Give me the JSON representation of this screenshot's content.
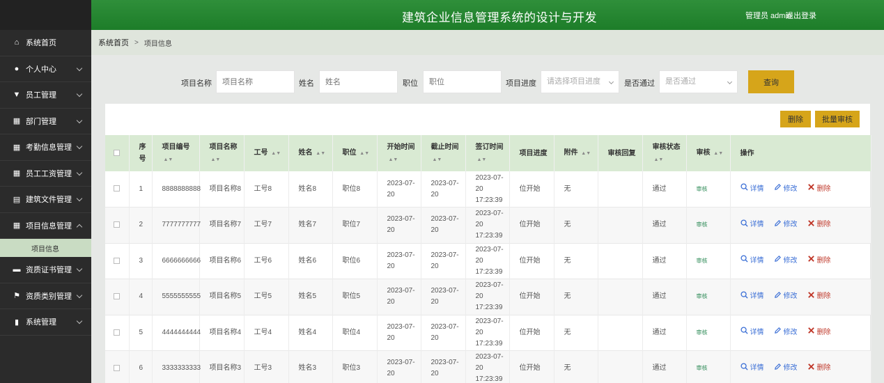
{
  "header": {
    "title": "建筑企业信息管理系统的设计与开发",
    "user_label": "管理员 admin",
    "logout": "退出登录"
  },
  "breadcrumb": {
    "home": "系统首页",
    "current": "项目信息"
  },
  "sidebar": {
    "items": [
      {
        "label": "系统首页",
        "icon": "home-icon"
      },
      {
        "label": "个人中心",
        "icon": "user-icon"
      },
      {
        "label": "员工管理",
        "icon": "trophy-icon"
      },
      {
        "label": "部门管理",
        "icon": "grid-icon"
      },
      {
        "label": "考勤信息管理",
        "icon": "grid-icon"
      },
      {
        "label": "员工工资管理",
        "icon": "table-icon"
      },
      {
        "label": "建筑文件管理",
        "icon": "clipboard-icon"
      },
      {
        "label": "项目信息管理",
        "icon": "grid-icon"
      },
      {
        "label": "资质证书管理",
        "icon": "ticket-icon"
      },
      {
        "label": "资质类别管理",
        "icon": "flag-icon"
      },
      {
        "label": "系统管理",
        "icon": "bar-chart-icon"
      }
    ],
    "sub_item": "项目信息"
  },
  "search": {
    "project_name_label": "项目名称",
    "project_name_placeholder": "项目名称",
    "name_label": "姓名",
    "name_placeholder": "姓名",
    "position_label": "职位",
    "position_placeholder": "职位",
    "progress_label": "项目进度",
    "progress_placeholder": "请选择项目进度",
    "passed_label": "是否通过",
    "passed_placeholder": "是否通过",
    "query_button": "查询"
  },
  "toolbar": {
    "delete_button": "删除",
    "batch_audit_button": "批量审核"
  },
  "table": {
    "headers": {
      "index": "序号",
      "code": "项目编号",
      "name": "项目名称",
      "job_no": "工号",
      "person": "姓名",
      "position": "职位",
      "start": "开始时间",
      "end": "截止时间",
      "sign": "签订时间",
      "progress": "项目进度",
      "attachment": "附件",
      "reply": "审核回复",
      "status": "审核状态",
      "audit": "审核",
      "ops": "操作"
    },
    "rows": [
      {
        "idx": "1",
        "code": "8888888888",
        "name": "项目名称8",
        "job": "工号8",
        "person": "姓名8",
        "pos": "职位8",
        "start": "2023-07-20",
        "end": "2023-07-20",
        "sign": "2023-07-20 17:23:39",
        "progress": "位开始",
        "att": "无",
        "reply": "",
        "status": "通过",
        "audit": "审核"
      },
      {
        "idx": "2",
        "code": "7777777777",
        "name": "项目名称7",
        "job": "工号7",
        "person": "姓名7",
        "pos": "职位7",
        "start": "2023-07-20",
        "end": "2023-07-20",
        "sign": "2023-07-20 17:23:39",
        "progress": "位开始",
        "att": "无",
        "reply": "",
        "status": "通过",
        "audit": "审核"
      },
      {
        "idx": "3",
        "code": "6666666666",
        "name": "项目名称6",
        "job": "工号6",
        "person": "姓名6",
        "pos": "职位6",
        "start": "2023-07-20",
        "end": "2023-07-20",
        "sign": "2023-07-20 17:23:39",
        "progress": "位开始",
        "att": "无",
        "reply": "",
        "status": "通过",
        "audit": "审核"
      },
      {
        "idx": "4",
        "code": "5555555555",
        "name": "项目名称5",
        "job": "工号5",
        "person": "姓名5",
        "pos": "职位5",
        "start": "2023-07-20",
        "end": "2023-07-20",
        "sign": "2023-07-20 17:23:39",
        "progress": "位开始",
        "att": "无",
        "reply": "",
        "status": "通过",
        "audit": "审核"
      },
      {
        "idx": "5",
        "code": "4444444444",
        "name": "项目名称4",
        "job": "工号4",
        "person": "姓名4",
        "pos": "职位4",
        "start": "2023-07-20",
        "end": "2023-07-20",
        "sign": "2023-07-20 17:23:39",
        "progress": "位开始",
        "att": "无",
        "reply": "",
        "status": "通过",
        "audit": "审核"
      },
      {
        "idx": "6",
        "code": "3333333333",
        "name": "项目名称3",
        "job": "工号3",
        "person": "姓名3",
        "pos": "职位3",
        "start": "2023-07-20",
        "end": "2023-07-20",
        "sign": "2023-07-20 17:23:39",
        "progress": "位开始",
        "att": "无",
        "reply": "",
        "status": "通过",
        "audit": "审核"
      }
    ],
    "ops": {
      "detail": "详情",
      "edit": "修改",
      "delete": "删除"
    }
  },
  "colors": {
    "header_green": "#1d7d29",
    "accent_gold": "#d6a51a",
    "sidebar_bg": "#2b2b2b",
    "table_header": "#d9ead3"
  }
}
